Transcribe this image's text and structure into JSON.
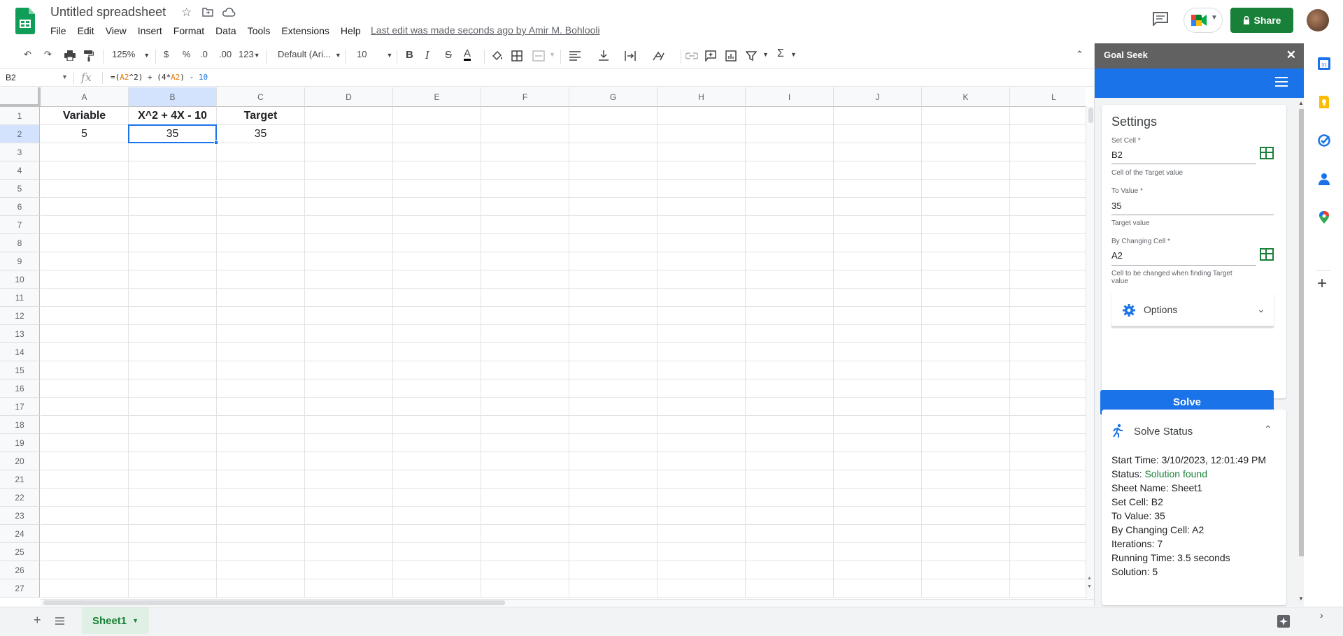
{
  "header": {
    "title": "Untitled spreadsheet",
    "menu": [
      "File",
      "Edit",
      "View",
      "Insert",
      "Format",
      "Data",
      "Tools",
      "Extensions",
      "Help"
    ],
    "last_edit": "Last edit was made seconds ago by Amir M. Bohlooli",
    "share_label": "Share",
    "brand_color": "#188038"
  },
  "toolbar": {
    "zoom": "125%",
    "currency": "$",
    "percent": "%",
    "dec_decrease": ".0",
    "dec_increase": ".00",
    "format_more": "123",
    "font": "Default (Ari...",
    "font_size": "10",
    "bold": "B",
    "italic": "I",
    "strike": "S",
    "text_color": "A"
  },
  "formula_bar": {
    "cell_ref": "B2",
    "fx": "fx",
    "formula_prefix": "=(",
    "ref1": "A2",
    "part2": "^2) + (4*",
    "ref2": "A2",
    "part3": ") - ",
    "const": "10"
  },
  "grid": {
    "columns": [
      "A",
      "B",
      "C",
      "D",
      "E",
      "F",
      "G",
      "H",
      "I",
      "J",
      "K",
      "L"
    ],
    "rows": [
      "1",
      "2",
      "3",
      "4",
      "5",
      "6",
      "7",
      "8",
      "9",
      "10",
      "11",
      "12",
      "13",
      "14",
      "15",
      "16",
      "17",
      "18",
      "19",
      "20",
      "21",
      "22",
      "23",
      "24",
      "25",
      "26",
      "27"
    ],
    "cells": {
      "A1": "Variable",
      "B1": "X^2 + 4X - 10",
      "C1": "Target",
      "A2": "5",
      "B2": "35",
      "C2": "35"
    }
  },
  "sheets": {
    "active": "Sheet1"
  },
  "panel": {
    "title": "Goal Seek",
    "settings_heading": "Settings",
    "set_cell_label": "Set Cell *",
    "set_cell_value": "B2",
    "set_cell_hint": "Cell of the Target value",
    "to_value_label": "To Value *",
    "to_value_value": "35",
    "to_value_hint": "Target value",
    "changing_cell_label": "By Changing Cell *",
    "changing_cell_value": "A2",
    "changing_cell_hint": "Cell to be changed when finding Target value",
    "options_label": "Options",
    "solve_label": "Solve",
    "status_heading": "Solve Status",
    "status": {
      "start_time": "Start Time: 3/10/2023, 12:01:49 PM",
      "status_prefix": "Status: ",
      "status_value": "Solution found",
      "sheet_name": "Sheet Name: Sheet1",
      "set_cell": "Set Cell: B2",
      "to_value": "To Value: 35",
      "changing_cell": "By Changing Cell: A2",
      "iterations": "Iterations: 7",
      "running_time": "Running Time: 3.5 seconds",
      "solution": "Solution: 5"
    },
    "accent_color": "#1a73e8",
    "success_color": "#188038"
  }
}
